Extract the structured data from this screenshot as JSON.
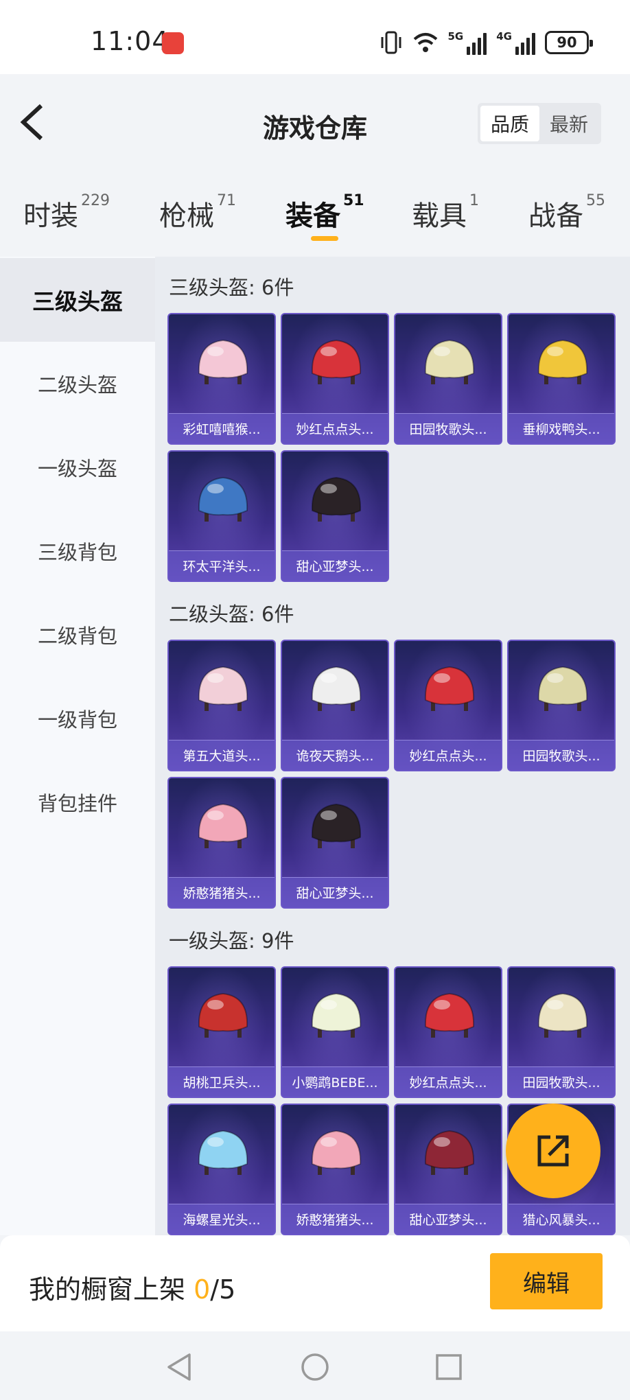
{
  "status_bar": {
    "time": "11:04",
    "battery": "90",
    "network_5g": "5G",
    "network_4g": "4G"
  },
  "header": {
    "title": "游戏仓库",
    "sort_options": [
      "品质",
      "最新"
    ],
    "sort_selected": "品质"
  },
  "tabs": [
    {
      "label": "时装",
      "count": "229"
    },
    {
      "label": "枪械",
      "count": "71"
    },
    {
      "label": "装备",
      "count": "51"
    },
    {
      "label": "载具",
      "count": "1"
    },
    {
      "label": "战备",
      "count": "55"
    }
  ],
  "active_tab": "装备",
  "sidebar": {
    "items": [
      "三级头盔",
      "二级头盔",
      "一级头盔",
      "三级背包",
      "二级背包",
      "一级背包",
      "背包挂件"
    ],
    "active": "三级头盔"
  },
  "sections": [
    {
      "title": "三级头盔: 6件",
      "items": [
        {
          "name": "彩虹嘻嘻猴...",
          "color": "#f4c7d6",
          "icon": "helmet-icon"
        },
        {
          "name": "妙红点点头...",
          "color": "#d8333a",
          "icon": "helmet-icon"
        },
        {
          "name": "田园牧歌头...",
          "color": "#e6e0b4",
          "icon": "helmet-icon"
        },
        {
          "name": "垂柳戏鸭头...",
          "color": "#f0c63a",
          "icon": "helmet-icon"
        },
        {
          "name": "环太平洋头...",
          "color": "#3f78c4",
          "icon": "helmet-icon"
        },
        {
          "name": "甜心亚梦头...",
          "color": "#2a2226",
          "icon": "helmet-icon"
        }
      ]
    },
    {
      "title": "二级头盔: 6件",
      "items": [
        {
          "name": "第五大道头...",
          "color": "#f2cfd8",
          "icon": "helmet-icon"
        },
        {
          "name": "诡夜天鹅头...",
          "color": "#eeeeee",
          "icon": "helmet-icon"
        },
        {
          "name": "妙红点点头...",
          "color": "#d8333a",
          "icon": "helmet-icon"
        },
        {
          "name": "田园牧歌头...",
          "color": "#ddd8a8",
          "icon": "helmet-icon"
        },
        {
          "name": "娇憨猪猪头...",
          "color": "#f2a7b8",
          "icon": "helmet-icon"
        },
        {
          "name": "甜心亚梦头...",
          "color": "#2a2226",
          "icon": "helmet-icon"
        }
      ]
    },
    {
      "title": "一级头盔: 9件",
      "items": [
        {
          "name": "胡桃卫兵头...",
          "color": "#c8322e",
          "icon": "helmet-icon"
        },
        {
          "name": "小鹦鹉BEBE...",
          "color": "#eef3d8",
          "icon": "helmet-icon"
        },
        {
          "name": "妙红点点头...",
          "color": "#d8333a",
          "icon": "helmet-icon"
        },
        {
          "name": "田园牧歌头...",
          "color": "#ece4c4",
          "icon": "helmet-icon"
        },
        {
          "name": "海螺星光头...",
          "color": "#8fd3f2",
          "icon": "helmet-icon"
        },
        {
          "name": "娇憨猪猪头...",
          "color": "#f2a7b8",
          "icon": "helmet-icon"
        },
        {
          "name": "甜心亚梦头...",
          "color": "#8e2636",
          "icon": "helmet-icon"
        },
        {
          "name": "猎心风暴头...",
          "color": "#7f79c9",
          "icon": "helmet-icon"
        }
      ]
    }
  ],
  "bottom_bar": {
    "label": "我的橱窗上架 ",
    "count": "0",
    "total": "/5",
    "edit_label": "编辑"
  },
  "colors": {
    "accent": "#ffb11b",
    "card_bg": "#2d2a72"
  }
}
